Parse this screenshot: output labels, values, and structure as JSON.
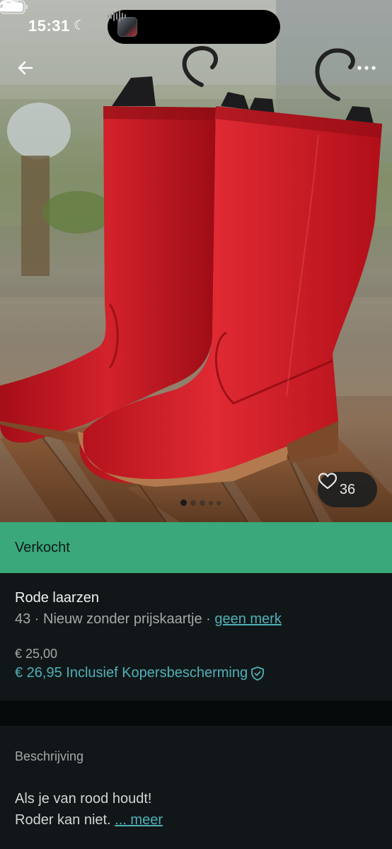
{
  "status_bar": {
    "time": "15:31"
  },
  "icons": {
    "back": "arrow-left-icon",
    "more": "more-horizontal-icon",
    "like": "heart-icon",
    "protection": "shield-check-icon"
  },
  "gallery": {
    "like_count": "36",
    "page_count": 5,
    "active_page": 1
  },
  "banner": {
    "status": "Verkocht",
    "color": "#3aa87b"
  },
  "item": {
    "title": "Rode laarzen",
    "size_condition": "43 · Nieuw zonder prijskaartje · ",
    "brand": "geen merk",
    "price": "€ 25,00",
    "price_protected": "€ 26,95 Inclusief Kopersbescherming",
    "accent_color": "#4fb0b8"
  },
  "description": {
    "label": "Beschrijving",
    "line1": "Als je van rood houdt!",
    "line2": "Roder kan niet. ",
    "more": "... meer"
  }
}
